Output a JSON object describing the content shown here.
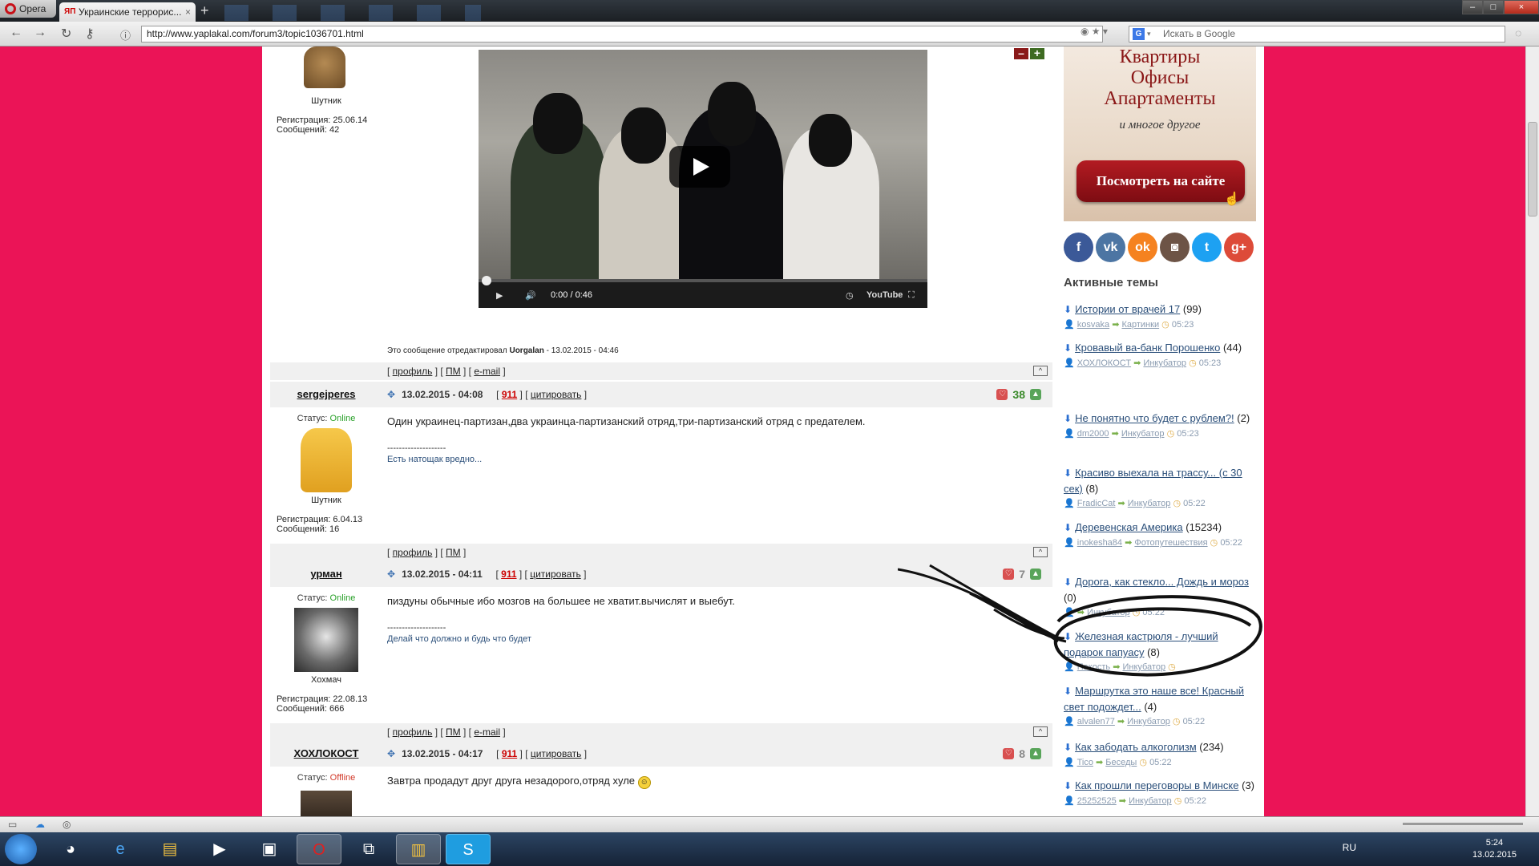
{
  "browser": {
    "app_button": "Opera",
    "tab_title": "Украинские террорис...",
    "url": "http://www.yaplakal.com/forum3/topic1036701.html",
    "search_placeholder": "Искать в Google"
  },
  "posts": [
    {
      "author_rank": "Шутник",
      "registration": "Регистрация: 25.06.14",
      "messages": "Сообщений: 42",
      "edited_prefix": "Это сообщение отредактировал",
      "edited_by": "Uorgalan",
      "edited_date": "- 13.02.2015 - 04:46",
      "footer": [
        "профиль",
        "ПМ",
        "e-mail"
      ],
      "video": {
        "time": "0:00 / 0:46",
        "brand": "YouTube"
      }
    },
    {
      "author": "sergejperes",
      "date": "13.02.2015 - 04:08",
      "report": "911",
      "quote": "цитировать",
      "rating": "38",
      "status_label": "Статус:",
      "status": "Online",
      "rank": "Шутник",
      "registration": "Регистрация: 6.04.13",
      "messages": "Сообщений: 16",
      "text": "Один украинец-партизан,два украинца-партизанский отряд,три-партизанский отряд с предателем.",
      "sig_dash": "--------------------",
      "signature": "Есть натощак вредно...",
      "footer": [
        "профиль",
        "ПМ"
      ]
    },
    {
      "author": "урман",
      "date": "13.02.2015 - 04:11",
      "report": "911",
      "quote": "цитировать",
      "rating": "7",
      "status_label": "Статус:",
      "status": "Online",
      "rank": "Хохмач",
      "registration": "Регистрация: 22.08.13",
      "messages": "Сообщений: 666",
      "text": "пиздуны обычные ибо мозгов на большее не хватит.вычислят и выебут.",
      "sig_dash": "--------------------",
      "signature": "Делай что должно и будь что будет",
      "footer": [
        "профиль",
        "ПМ",
        "e-mail"
      ]
    },
    {
      "author": "ХОХЛОКОСТ",
      "date": "13.02.2015 - 04:17",
      "report": "911",
      "quote": "цитировать",
      "rating": "8",
      "status_label": "Статус:",
      "status": "Offline",
      "text": "Завтра продадут друг друга незадорого,отряд хуле"
    }
  ],
  "ad": {
    "line1": "Квартиры",
    "line2": "Офисы",
    "line3": "Апартаменты",
    "small": "и многое другое",
    "button": "Посмотреть на сайте"
  },
  "social": [
    {
      "name": "facebook",
      "glyph": "f",
      "color": "#3b5998"
    },
    {
      "name": "vk",
      "glyph": "vk",
      "color": "#4c75a3"
    },
    {
      "name": "odnoklassniki",
      "glyph": "ok",
      "color": "#f58220"
    },
    {
      "name": "instagram",
      "glyph": "◙",
      "color": "#6d5446"
    },
    {
      "name": "twitter",
      "glyph": "t",
      "color": "#1da1f2"
    },
    {
      "name": "googleplus",
      "glyph": "g+",
      "color": "#dd4b39"
    }
  ],
  "active_topics": {
    "title": "Активные темы",
    "items": [
      {
        "title": "Истории от врачей 17",
        "count": "(99)",
        "user": "kosvaka",
        "section": "Картинки",
        "time": "05:23"
      },
      {
        "title": "Кровавый ва-банк Порошенко",
        "count": "(44)",
        "user": "ХОХЛОКОСТ",
        "section": "Инкубатор",
        "time": "05:23"
      },
      {
        "title": "Не понятно что будет с рублем?!",
        "count": "(2)",
        "user": "dm2000",
        "section": "Инкубатор",
        "time": "05:23"
      },
      {
        "title": "Красиво выехала на трассу... (с 30 сек)",
        "count": "(8)",
        "user": "FradicCat",
        "section": "Инкубатор",
        "time": "05:22"
      },
      {
        "title": "Деревенская Америка",
        "count": "(15234)",
        "user": "inokesha84",
        "section": "Фотопутешествия",
        "time": "05:22"
      },
      {
        "title": "Дорога, как стекло... Дождь и мороз",
        "count": "(0)",
        "user": "",
        "section": "Инкубатор",
        "time": "05:22"
      },
      {
        "title": "Железная кастрюля - лучший подарок папуасу",
        "count": "(8)",
        "user": "Пакость",
        "section": "Инкубатор",
        "time": ""
      },
      {
        "title": "Маршрутка это наше все! Красный свет подождет...",
        "count": "(4)",
        "user": "alvalen77",
        "section": "Инкубатор",
        "time": "05:22"
      },
      {
        "title": "Как забодать алкоголизм",
        "count": "(234)",
        "user": "Tico",
        "section": "Беседы",
        "time": "05:22"
      },
      {
        "title": "Как прошли переговоры в Минске",
        "count": "(3)",
        "user": "25252525",
        "section": "Инкубатор",
        "time": "05:22"
      }
    ]
  },
  "taskbar": {
    "lang": "RU",
    "time": "5:24",
    "date": "13.02.2015"
  }
}
